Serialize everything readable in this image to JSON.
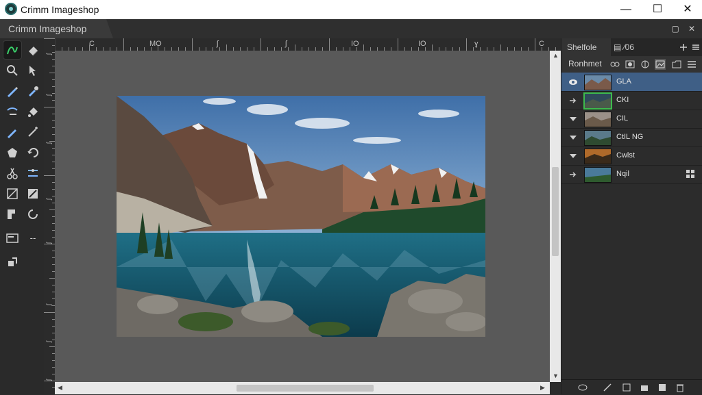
{
  "app": {
    "window_title": "Crimm Imageshop",
    "document_tab": "Crimm Imageshop",
    "accent_color": "#3f5f86",
    "highlight_color": "#3dbb4d"
  },
  "window_controls": {
    "minimize": "—",
    "maximize": "☐",
    "close": "✕"
  },
  "docbar_controls": {
    "restore": "▢",
    "close": "✕"
  },
  "ruler": {
    "h_labels": [
      "C",
      "MO",
      "ʃ",
      "ʃ",
      "IO",
      "IO",
      "ɣ",
      "C"
    ],
    "v_labels": [
      "ʃ",
      "ʃ",
      "ʃ",
      "ʃ",
      "ʃ",
      "ʃ",
      "ʃ",
      "ʃ",
      "ʃ"
    ]
  },
  "tools": [
    {
      "name": "lasso-tool",
      "icon": "lasso-icon",
      "active": true
    },
    {
      "name": "eraser-tool",
      "icon": "eraser-icon"
    },
    {
      "name": "zoom-tool",
      "icon": "zoom-icon"
    },
    {
      "name": "move-tool",
      "icon": "arrow-cursor-icon"
    },
    {
      "name": "pen-tool",
      "icon": "pen-icon"
    },
    {
      "name": "dropper-tool",
      "icon": "dropper-icon"
    },
    {
      "name": "brush-tool",
      "icon": "brush-icon"
    },
    {
      "name": "fill-tool",
      "icon": "fill-icon"
    },
    {
      "name": "pencil-tool",
      "icon": "pencil-icon"
    },
    {
      "name": "wand-tool",
      "icon": "wand-icon"
    },
    {
      "name": "shape-tool",
      "icon": "polygon-icon"
    },
    {
      "name": "rotate-tool",
      "icon": "rotate-icon"
    },
    {
      "name": "scissors-tool",
      "icon": "scissors-icon"
    },
    {
      "name": "path-tool",
      "icon": "path-icon"
    },
    {
      "name": "transform-tool",
      "icon": "transform-icon"
    },
    {
      "name": "warp-tool",
      "icon": "warp-icon"
    },
    {
      "name": "select-tool",
      "icon": "select-icon"
    },
    {
      "name": "refresh-tool",
      "icon": "refresh-icon"
    },
    {
      "name": "screen-tool",
      "icon": "screen-icon"
    },
    {
      "name": "more-tool",
      "icon": "ellipsis-icon",
      "label": "--"
    },
    {
      "name": "stamp-tool",
      "icon": "stamp-icon"
    }
  ],
  "layers_panel": {
    "tabs": [
      "Shelfole",
      "▤ ∕06"
    ],
    "blend_label": "Ronhmet",
    "layers": [
      {
        "name": "GLA",
        "selected": true
      },
      {
        "name": "CKI"
      },
      {
        "name": "CIL"
      },
      {
        "name": "CtIL NG"
      },
      {
        "name": "Cwlst"
      },
      {
        "name": "Nqil"
      }
    ]
  }
}
